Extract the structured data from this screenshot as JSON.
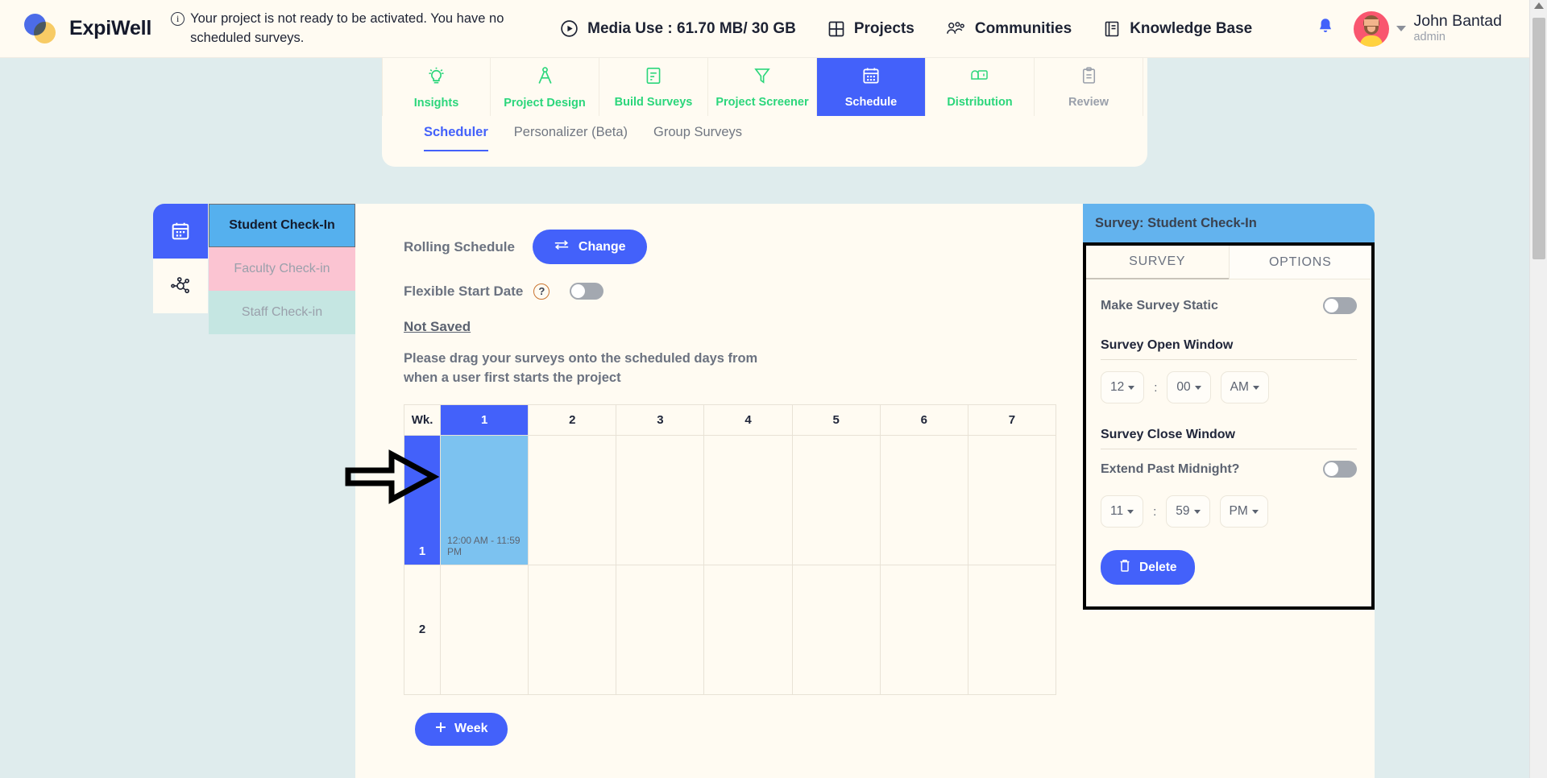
{
  "brand": {
    "name": "ExpiWell"
  },
  "alert": {
    "text": "Your project is not ready to be activated. You have no scheduled surveys."
  },
  "topnav": [
    {
      "label": "Media Use : 61.70 MB/ 30 GB",
      "icon": "play-circle-icon"
    },
    {
      "label": "Projects",
      "icon": "grid-icon"
    },
    {
      "label": "Communities",
      "icon": "people-icon"
    },
    {
      "label": "Knowledge Base",
      "icon": "book-icon"
    }
  ],
  "user": {
    "name": "John Bantad",
    "role": "admin"
  },
  "main_tabs": [
    {
      "label": "Insights",
      "state": "normal"
    },
    {
      "label": "Project Design",
      "state": "normal"
    },
    {
      "label": "Build Surveys",
      "state": "normal"
    },
    {
      "label": "Project Screener",
      "state": "normal"
    },
    {
      "label": "Schedule",
      "state": "active"
    },
    {
      "label": "Distribution",
      "state": "normal"
    },
    {
      "label": "Review",
      "state": "disabled"
    }
  ],
  "sub_tabs": [
    {
      "label": "Scheduler",
      "active": true
    },
    {
      "label": "Personalizer (Beta)",
      "active": false
    },
    {
      "label": "Group Surveys",
      "active": false
    }
  ],
  "survey_list": [
    {
      "label": "Student Check-In",
      "state": "selected",
      "color": "#55b0ee"
    },
    {
      "label": "Faculty Check-in",
      "state": "normal",
      "color": "#fbc4d2"
    },
    {
      "label": "Staff Check-in",
      "state": "normal",
      "color": "#c5e6e2"
    }
  ],
  "scheduler": {
    "rolling_label": "Rolling Schedule",
    "change_button": "Change",
    "flexible_label": "Flexible Start Date",
    "flexible_help": "?",
    "flexible_on": false,
    "not_saved": "Not Saved",
    "drag_text": "Please drag your surveys onto the scheduled days from when a user first starts the project",
    "add_week_button": "Week",
    "calendar": {
      "week_header": "Wk.",
      "day_headers": [
        "1",
        "2",
        "3",
        "4",
        "5",
        "6",
        "7"
      ],
      "active_day": "1",
      "weeks": [
        {
          "number": "1",
          "highlighted": true,
          "cells": [
            {
              "filled": true,
              "slot": "12:00 AM - 11:59 PM"
            },
            {},
            {},
            {},
            {},
            {},
            {}
          ]
        },
        {
          "number": "2",
          "highlighted": false,
          "cells": [
            {},
            {},
            {},
            {},
            {},
            {},
            {}
          ]
        }
      ]
    }
  },
  "right_panel": {
    "title": "Survey: Student Check-In",
    "tabs": [
      {
        "label": "SURVEY",
        "active": true
      },
      {
        "label": "OPTIONS",
        "active": false
      }
    ],
    "make_static_label": "Make Survey Static",
    "make_static_on": false,
    "open_window_title": "Survey Open Window",
    "open_hour": "12",
    "open_minute": "00",
    "open_meridiem": "AM",
    "close_window_title": "Survey Close Window",
    "extend_label": "Extend Past Midnight?",
    "extend_on": false,
    "close_hour": "11",
    "close_minute": "59",
    "close_meridiem": "PM",
    "delete_button": "Delete",
    "time_separator": ":"
  },
  "colors": {
    "accent_blue": "#4361fa",
    "green": "#2bd67b",
    "cream": "#fffbf2",
    "page_bg": "#dfeced",
    "survey_blue": "#7cc2f0"
  }
}
